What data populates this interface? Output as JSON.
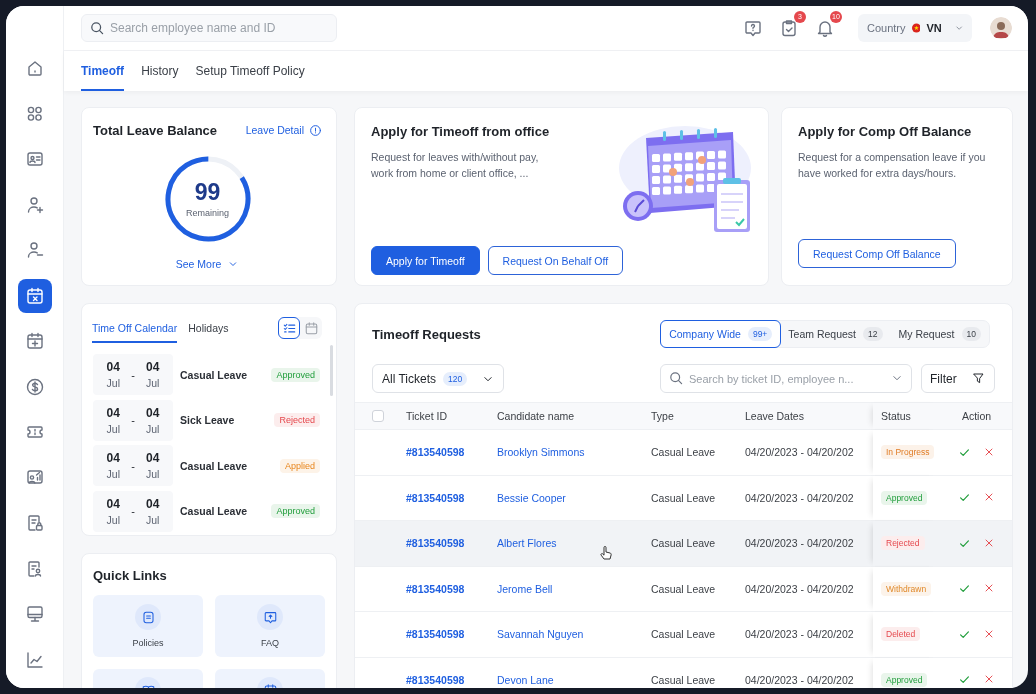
{
  "sidebar": {
    "items": [
      {
        "selected": false
      },
      {
        "selected": false
      },
      {
        "selected": false
      },
      {
        "selected": false
      },
      {
        "selected": false
      },
      {
        "selected": true
      },
      {
        "selected": false
      },
      {
        "selected": false
      },
      {
        "selected": false
      },
      {
        "selected": false
      },
      {
        "selected": false
      },
      {
        "selected": false
      },
      {
        "selected": false
      },
      {
        "selected": false
      }
    ]
  },
  "header": {
    "search": {
      "placeholder": "Search employee name and ID"
    },
    "badges": {
      "tasks": "3",
      "notifications": "10"
    },
    "country": {
      "label": "Country",
      "value": "VN"
    }
  },
  "tabs": [
    {
      "label": "Timeoff",
      "selected": true
    },
    {
      "label": "History",
      "selected": false
    },
    {
      "label": "Setup Timeoff Policy",
      "selected": false
    }
  ],
  "leave_balance": {
    "title": "Total Leave Balance",
    "link": "Leave Detail",
    "value": "99",
    "caption": "Remaining",
    "level": 0.84,
    "more": "See More"
  },
  "apply_cards": [
    {
      "title": "Apply for Timeoff from office",
      "text": "Request for leaves with/without pay, work from home or client office, ...",
      "illustration": true,
      "buttons": [
        {
          "label": "Apply for Timeoff",
          "kind": "primary"
        },
        {
          "label": "Request On Behalf Off",
          "kind": "outline"
        }
      ]
    },
    {
      "title": "Apply for Comp Off Balance",
      "text": "Request for a compensation leave if you have worked for extra days/hours.",
      "illustration": false,
      "buttons": [
        {
          "label": "Request Comp Off Balance",
          "kind": "outline"
        }
      ]
    }
  ],
  "calendar": {
    "tabs": [
      {
        "label": "Time Off Calendar",
        "selected": true
      },
      {
        "label": "Holidays",
        "selected": false
      }
    ],
    "views": [
      {
        "selected": true
      },
      {
        "selected": false
      }
    ],
    "entries": [
      {
        "from_day": "04",
        "from_month": "Jul",
        "separator": "-",
        "to_day": "04",
        "to_month": "Jul",
        "type": "Casual Leave",
        "status": "Approved",
        "kind": "approved"
      },
      {
        "from_day": "04",
        "from_month": "Jul",
        "separator": "-",
        "to_day": "04",
        "to_month": "Jul",
        "type": "Sick Leave",
        "status": "Rejected",
        "kind": "rejected"
      },
      {
        "from_day": "04",
        "from_month": "Jul",
        "separator": "-",
        "to_day": "04",
        "to_month": "Jul",
        "type": "Casual Leave",
        "status": "Applied",
        "kind": "applied"
      },
      {
        "from_day": "04",
        "from_month": "Jul",
        "separator": "-",
        "to_day": "04",
        "to_month": "Jul",
        "type": "Casual Leave",
        "status": "Approved",
        "kind": "approved"
      }
    ]
  },
  "quick_links": {
    "title": "Quick Links",
    "items": [
      {
        "kind": "full",
        "label": "Policies"
      },
      {
        "kind": "full",
        "label": "FAQ"
      },
      {
        "kind": "cut"
      },
      {
        "kind": "cut"
      }
    ]
  },
  "requests": {
    "title": "Timeoff Requests",
    "scopes": [
      {
        "label": "Company Wide",
        "count": "99+",
        "selected": true
      },
      {
        "label": "Team Request",
        "count": "12",
        "selected": false
      },
      {
        "label": "My Request",
        "count": "10",
        "selected": false
      }
    ],
    "ticket_filter": {
      "label": "All Tickets",
      "count": "120"
    },
    "search": {
      "placeholder": "Search by ticket ID, employee n..."
    },
    "filter": "Filter",
    "select_all": {
      "checked": false
    },
    "columns": [
      "Ticket ID",
      "Candidate name",
      "Type",
      "Leave Dates",
      "Status",
      "Action"
    ],
    "rows": [
      {
        "ticket": "#813540598",
        "name": "Brooklyn Simmons",
        "type": "Casual Leave",
        "dates": "04/20/2023 - 04/20/202",
        "status": "In Progress",
        "kind": "progress",
        "selected": false
      },
      {
        "ticket": "#813540598",
        "name": "Bessie Cooper",
        "type": "Casual Leave",
        "dates": "04/20/2023 - 04/20/202",
        "status": "Approved",
        "kind": "approved",
        "selected": false
      },
      {
        "ticket": "#813540598",
        "name": "Albert Flores",
        "type": "Casual Leave",
        "dates": "04/20/2023 - 04/20/202",
        "status": "Rejected",
        "kind": "rejected",
        "selected": true
      },
      {
        "ticket": "#813540598",
        "name": "Jerome Bell",
        "type": "Casual Leave",
        "dates": "04/20/2023 - 04/20/202",
        "status": "Withdrawn",
        "kind": "withdrawn",
        "selected": false
      },
      {
        "ticket": "#813540598",
        "name": "Savannah Nguyen",
        "type": "Casual Leave",
        "dates": "04/20/2023 - 04/20/202",
        "status": "Deleted",
        "kind": "deleted",
        "selected": false
      },
      {
        "ticket": "#813540598",
        "name": "Devon Lane",
        "type": "Casual Leave",
        "dates": "04/20/2023 - 04/20/202",
        "status": "Approved",
        "kind": "approved",
        "selected": false
      }
    ]
  }
}
